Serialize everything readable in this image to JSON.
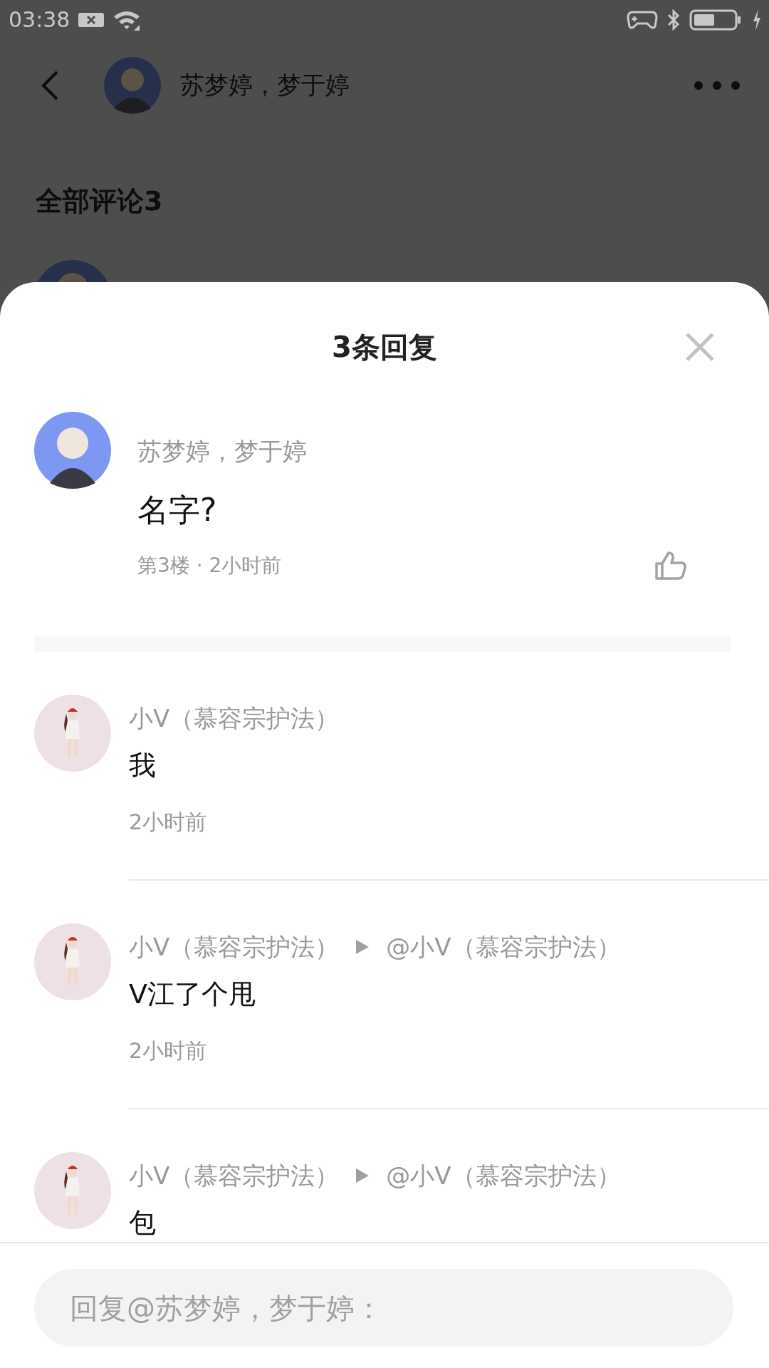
{
  "status_bar": {
    "time": "03:38"
  },
  "header": {
    "title": "苏梦婷，梦于婷"
  },
  "section": {
    "title": "全部评论3"
  },
  "sheet": {
    "title": "3条回复",
    "comment": {
      "author": "苏梦婷，梦于婷",
      "text": "名字?",
      "meta": "第3楼 · 2小时前"
    },
    "replies": [
      {
        "author": "小V（慕容宗护法）",
        "text": "我",
        "time": "2小时前"
      },
      {
        "author": "小V（慕容宗护法）",
        "reply_to": "@小V（慕容宗护法）",
        "text": "V江了个甩",
        "time": "2小时前"
      },
      {
        "author": "小V（慕容宗护法）",
        "reply_to": "@小V（慕容宗护法）",
        "text": "包"
      }
    ]
  },
  "reply_box": {
    "placeholder": "回复@苏梦婷，梦于婷："
  }
}
